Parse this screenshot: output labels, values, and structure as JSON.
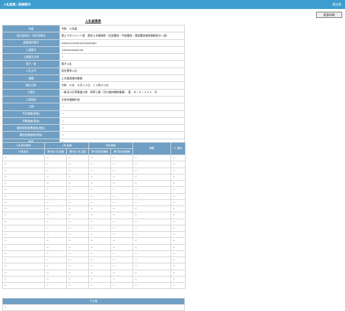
{
  "header": {
    "title": "入札結果／詳細表示",
    "user": "発注者"
  },
  "toolbar": {
    "print_label": "画面印刷"
  },
  "page_title": "入札結果表",
  "info_rows": [
    {
      "label": "年度",
      "value": "令和　６年度"
    },
    {
      "label": "発注部局名／発注所属名",
      "value": "県土マネジメント部　県央土木事務所（北部農林・中部農林・東部農林振興事務所の一部）"
    },
    {
      "label": "調達案件番号",
      "value": "290010130505202400060"
    },
    {
      "label": "工事番号",
      "value": "1305055060126"
    },
    {
      "label": "工事番号名称",
      "value": "－"
    },
    {
      "label": "電子／紙",
      "value": "電子入札"
    },
    {
      "label": "入札方式",
      "value": "指名競争入札"
    },
    {
      "label": "業種",
      "value": "土木施設維持業務"
    },
    {
      "label": "開札日時",
      "value": "令和　６年　８月１２日　１１時３０分"
    },
    {
      "label": "工事名",
      "value": "一級河川天草御道川他　除草工事（河川維持補修事業）　東　Ｎ－２－２１３　号"
    },
    {
      "label": "工事場所",
      "value": "天塚市篠郷町他"
    },
    {
      "label": "工期",
      "value": "－"
    },
    {
      "label": "予定価格(税抜)",
      "value": "－"
    },
    {
      "label": "予算価格(税抜)",
      "value": "－"
    },
    {
      "label": "最低制限基準価格(税抜)",
      "value": "－"
    },
    {
      "label": "最低制限価格(税抜)",
      "value": "－"
    },
    {
      "label": "備考",
      "value": "－"
    }
  ],
  "bid_table": {
    "group_headers": {
      "participant": "入札参加業者",
      "bid": "入札金額",
      "judge": "判定価格",
      "remarks": "摘要",
      "rank": "ｸｼﾞ番号"
    },
    "sub_headers": {
      "company": "代表者名",
      "bid1": "第1回入札金額",
      "bid2": "第2回入札金額",
      "judge1": "第1回判定価格",
      "judge2": "第2回判定価格"
    },
    "rows": [
      [
        "－",
        "－",
        "－",
        "－",
        "－",
        "－",
        "－"
      ],
      [
        "－",
        "－",
        "－",
        "－",
        "－",
        "－",
        "－"
      ],
      [
        "－",
        "－",
        "－",
        "－",
        "－",
        "－",
        "－"
      ],
      [
        "－",
        "－",
        "－",
        "－",
        "－",
        "－",
        "－"
      ],
      [
        "－",
        "－",
        "－",
        "－",
        "－",
        "－",
        "－"
      ],
      [
        "－",
        "－",
        "－",
        "－",
        "－",
        "－",
        "－"
      ],
      [
        "－",
        "－",
        "－",
        "－",
        "－",
        "－",
        "－"
      ],
      [
        "－",
        "－",
        "－",
        "－",
        "－",
        "－",
        "－"
      ],
      [
        "－",
        "－",
        "－",
        "－",
        "－",
        "－",
        "－"
      ],
      [
        "－",
        "－",
        "－",
        "－",
        "－",
        "－",
        "－"
      ],
      [
        "－",
        "－",
        "－",
        "－",
        "－",
        "－",
        "－"
      ],
      [
        "－",
        "－",
        "－",
        "－",
        "－",
        "－",
        "－"
      ],
      [
        "－",
        "－",
        "－",
        "－",
        "－",
        "－",
        "－"
      ],
      [
        "－",
        "－",
        "－",
        "－",
        "－",
        "－",
        "－"
      ],
      [
        "－",
        "－",
        "－",
        "－",
        "－",
        "－",
        "－"
      ],
      [
        "－",
        "－",
        "－",
        "－",
        "－",
        "－",
        "－"
      ],
      [
        "－",
        "－",
        "－",
        "－",
        "－",
        "－",
        "－"
      ],
      [
        "－",
        "－",
        "－",
        "－",
        "－",
        "－",
        "－"
      ],
      [
        "－",
        "－",
        "－",
        "－",
        "－",
        "－",
        "－"
      ],
      [
        "－",
        "－",
        "－",
        "－",
        "－",
        "－",
        "－"
      ],
      [
        "－",
        "－",
        "－",
        "－",
        "－",
        "－",
        "－"
      ]
    ]
  },
  "other": {
    "header": "その他",
    "value": "－"
  }
}
